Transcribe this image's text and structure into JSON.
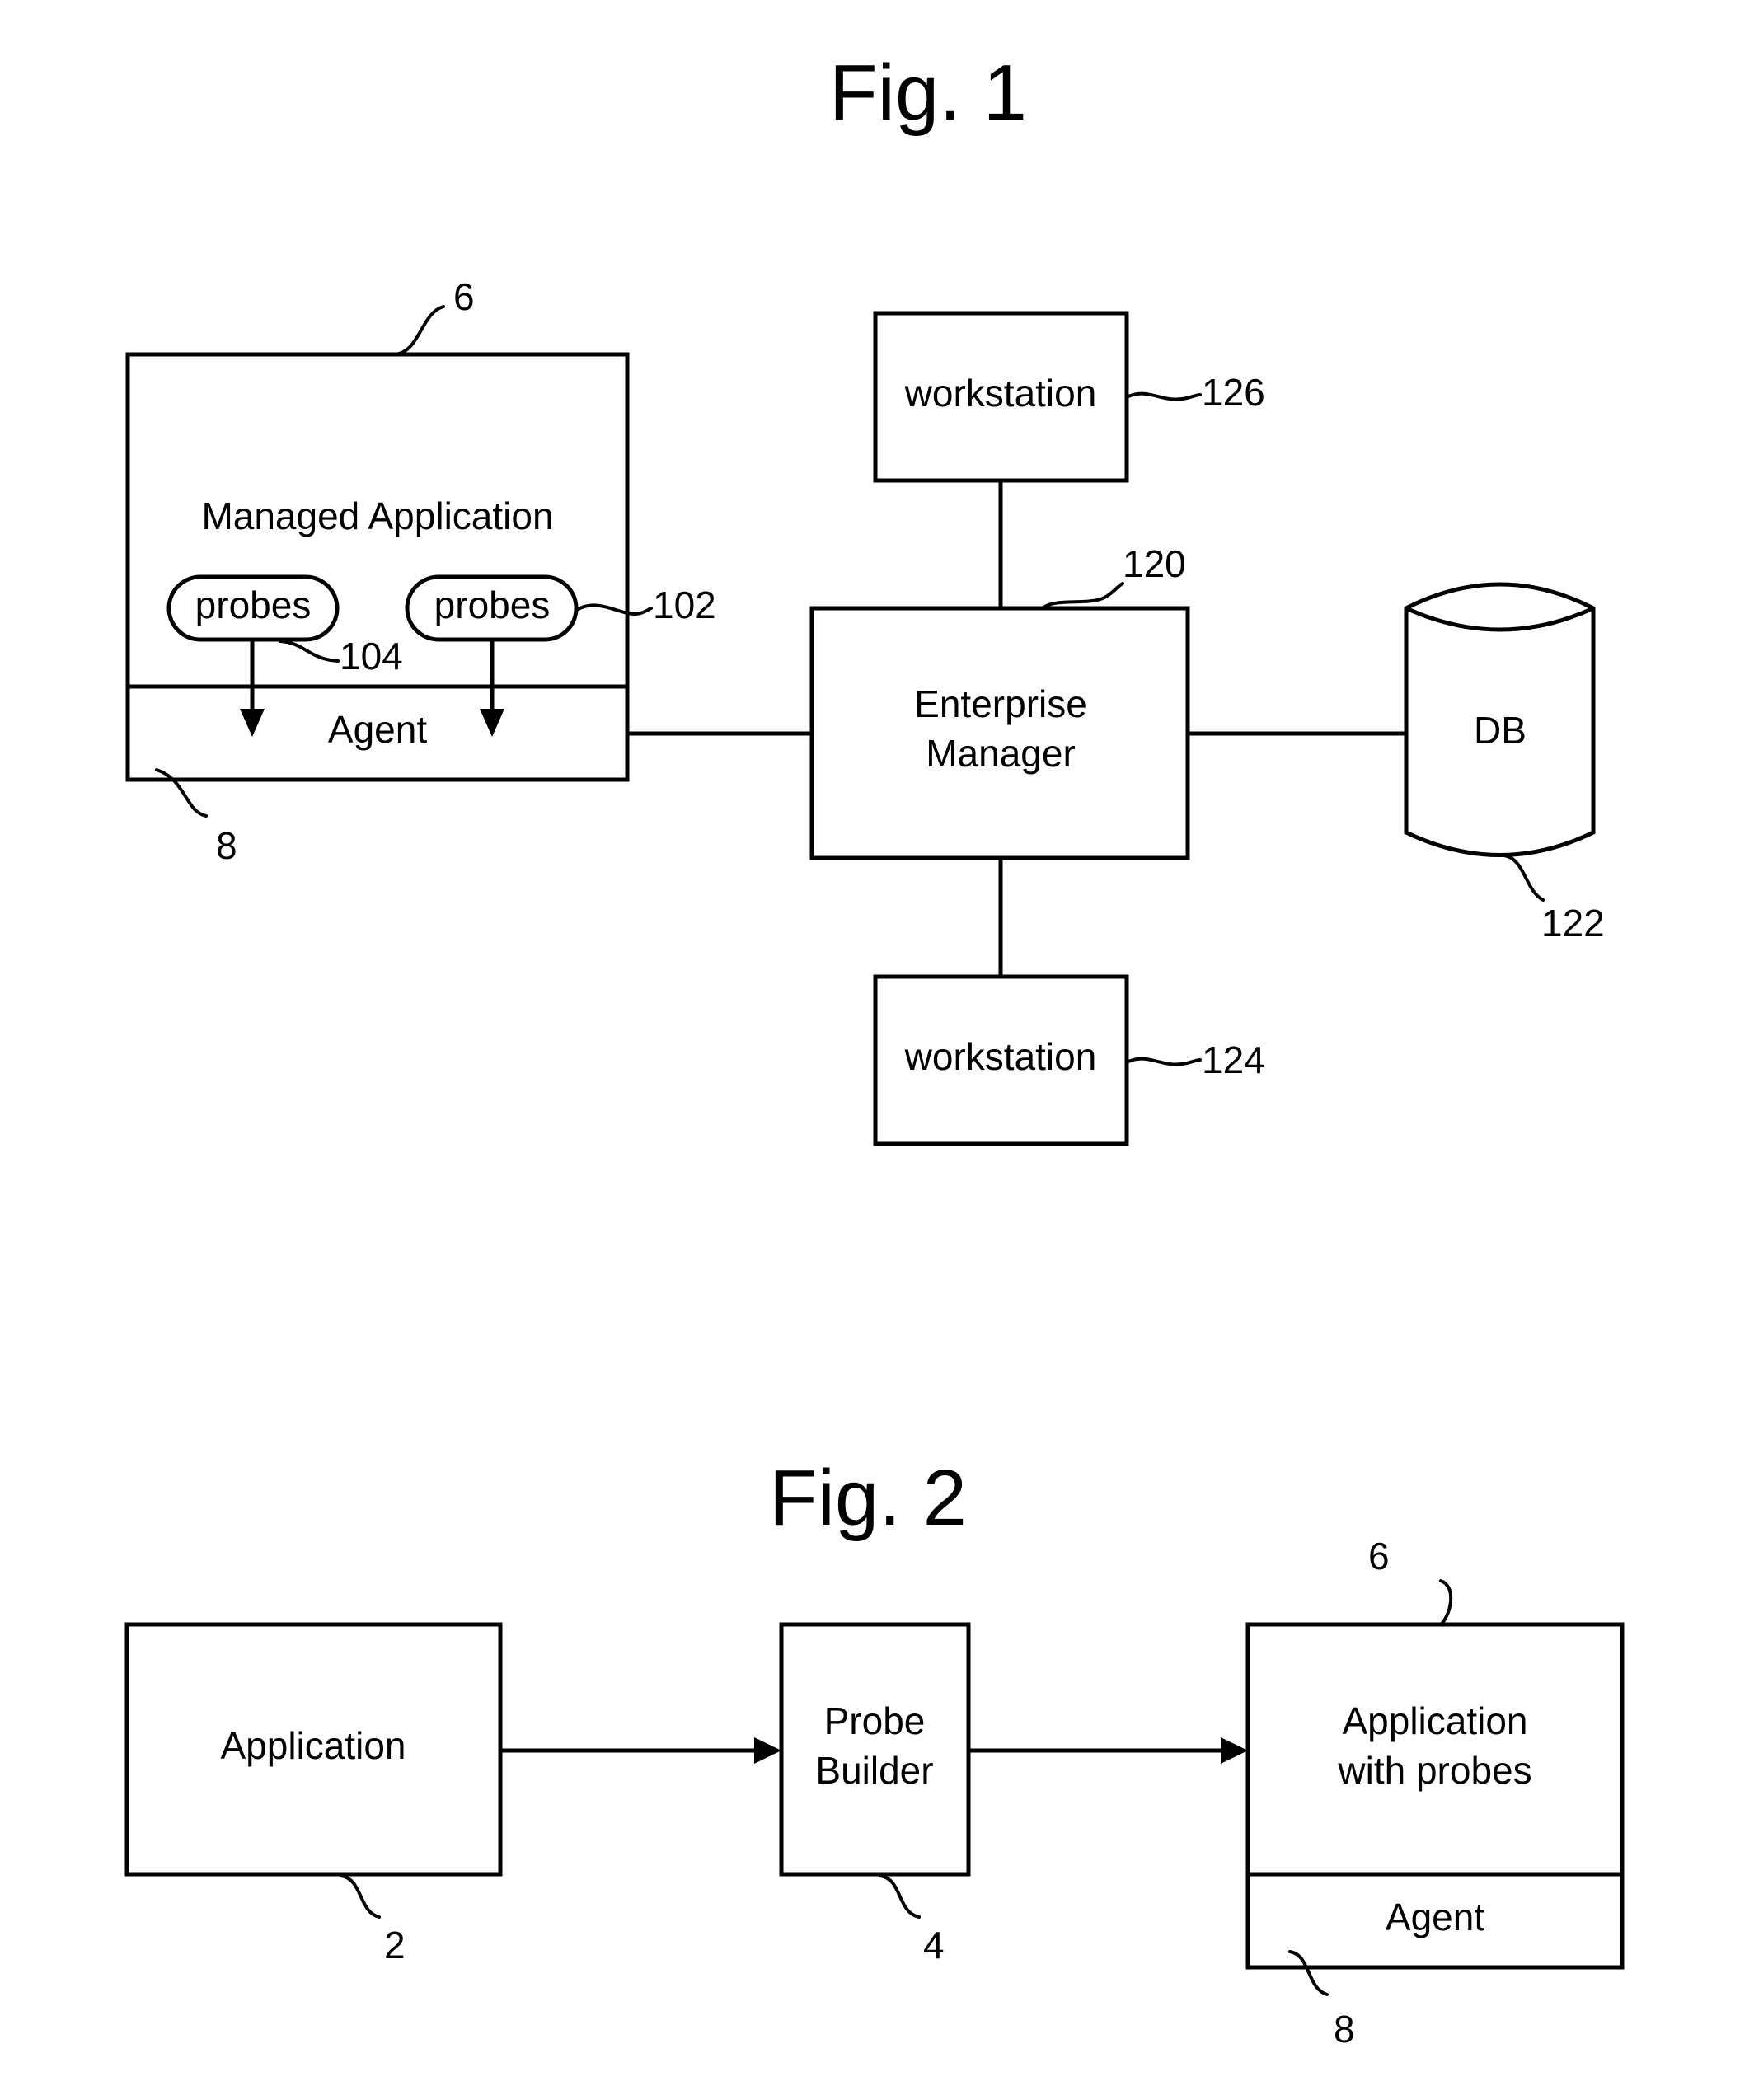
{
  "fig1": {
    "title": "Fig. 1",
    "managed_app": {
      "label": "Managed Application",
      "ref": "6",
      "agent_label": "Agent",
      "agent_ref": "8",
      "probes": [
        {
          "label": "probes",
          "ref": "104"
        },
        {
          "label": "probes",
          "ref": "102"
        }
      ]
    },
    "enterprise_manager": {
      "label_line1": "Enterprise",
      "label_line2": "Manager",
      "ref": "120"
    },
    "workstation_top": {
      "label": "workstation",
      "ref": "126"
    },
    "workstation_bottom": {
      "label": "workstation",
      "ref": "124"
    },
    "db": {
      "label": "DB",
      "ref": "122"
    }
  },
  "fig2": {
    "title": "Fig. 2",
    "application": {
      "label": "Application",
      "ref": "2"
    },
    "probe_builder": {
      "label_line1": "Probe",
      "label_line2": "Builder",
      "ref": "4"
    },
    "app_with_probes": {
      "label_line1": "Application",
      "label_line2": "with probes",
      "ref": "6",
      "agent_label": "Agent",
      "agent_ref": "8"
    }
  }
}
